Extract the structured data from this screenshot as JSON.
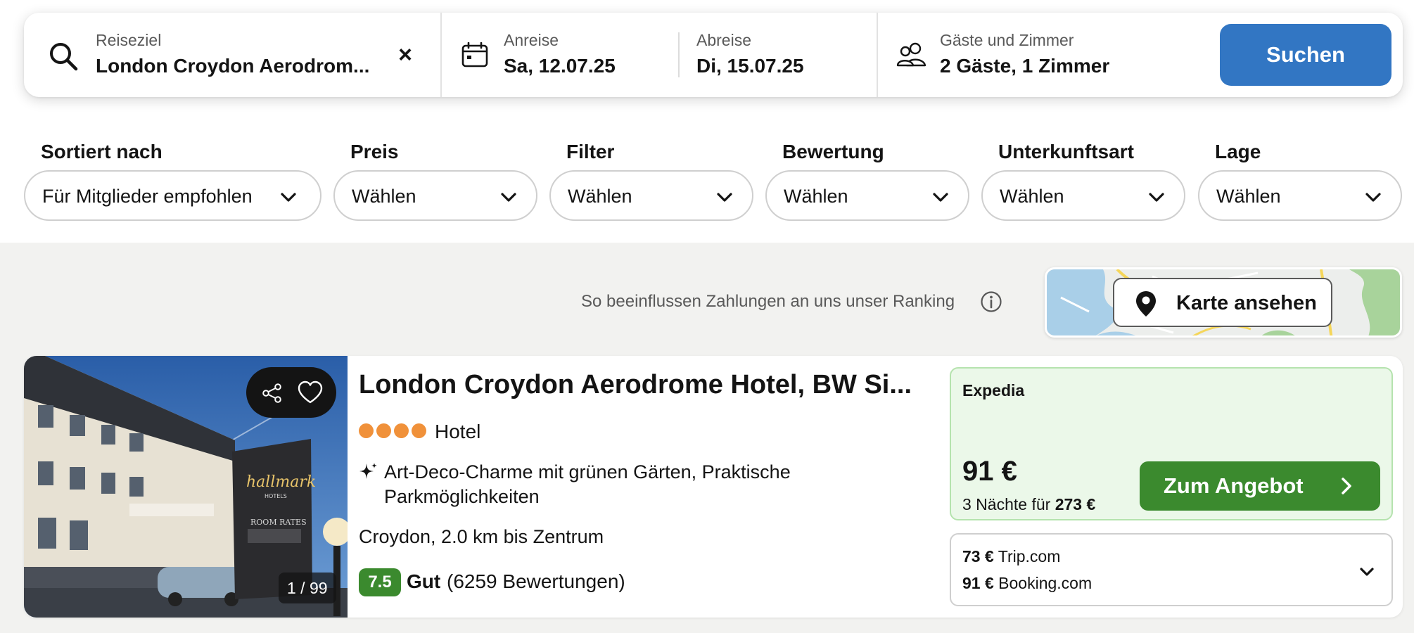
{
  "search": {
    "destination_label": "Reiseziel",
    "destination_value": "London Croydon Aerodrom...",
    "clear_symbol": "×",
    "checkin_label": "Anreise",
    "checkin_value": "Sa, 12.07.25",
    "checkout_label": "Abreise",
    "checkout_value": "Di, 15.07.25",
    "guests_label": "Gäste und Zimmer",
    "guests_value": "2 Gäste, 1 Zimmer",
    "submit_label": "Suchen",
    "accent_color": "#3276c3"
  },
  "filters": [
    {
      "label": "Sortiert nach",
      "value": "Für Mitglieder empfohlen"
    },
    {
      "label": "Preis",
      "value": "Wählen"
    },
    {
      "label": "Filter",
      "value": "Wählen"
    },
    {
      "label": "Bewertung",
      "value": "Wählen"
    },
    {
      "label": "Unterkunftsart",
      "value": "Wählen"
    },
    {
      "label": "Lage",
      "value": "Wählen"
    }
  ],
  "ranking_note": "So beeinflussen Zahlungen an uns unser Ranking",
  "map": {
    "button_label": "Karte ansehen"
  },
  "result": {
    "name": "London Croydon Aerodrome Hotel, BW Si...",
    "star_count": 4,
    "type": "Hotel",
    "highlights": "Art-Deco-Charme mit grünen Gärten, Praktische Parkmöglichkeiten",
    "location": "Croydon, 2.0 km bis Zentrum",
    "rating_score": "7.5",
    "rating_word": "Gut",
    "rating_count": "(6259 Bewertungen)",
    "photo_counter": "1 / 99",
    "photo_sign_brand": "hallmark",
    "photo_sign_sub": "HOTELS",
    "photo_sign_rates": "ROOM RATES",
    "deal": {
      "provider": "Expedia",
      "price": "91 €",
      "nights_text": "3 Nächte für",
      "total": "273 €",
      "button_label": "Zum Angebot",
      "color": "#3b8a2e"
    },
    "other_offers": [
      {
        "price": "73 €",
        "provider": "Trip.com"
      },
      {
        "price": "91 €",
        "provider": "Booking.com"
      }
    ]
  }
}
